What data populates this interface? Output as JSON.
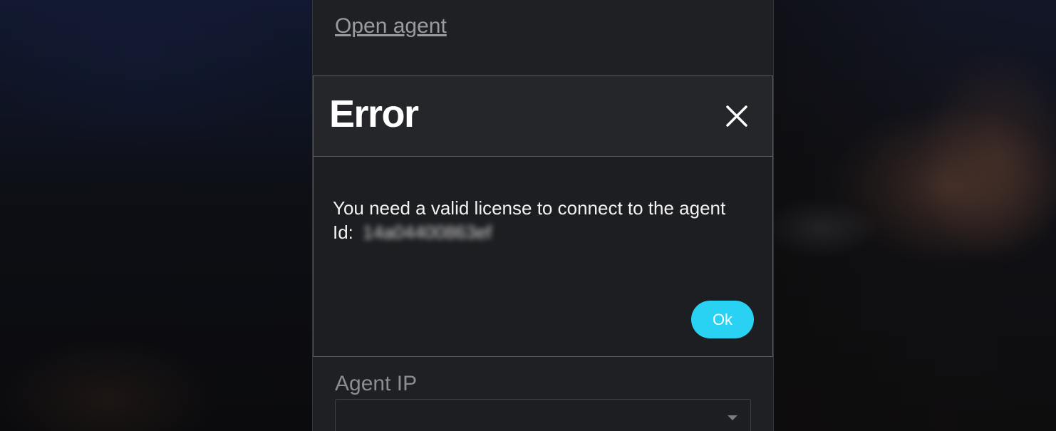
{
  "panel": {
    "open_agent_link": "Open agent",
    "agent_ip_label": "Agent IP",
    "agent_ip_value": ""
  },
  "dialog": {
    "title": "Error",
    "message": "You need a valid license to connect to the agent",
    "id_label": "Id:",
    "id_value": "14a04400863ef",
    "ok_label": "Ok",
    "close_icon": "close-icon"
  },
  "colors": {
    "accent": "#29d1f3",
    "panel_bg": "#1f2024",
    "dialog_bg": "#1d1e21",
    "dialog_header_bg": "#24262a"
  }
}
